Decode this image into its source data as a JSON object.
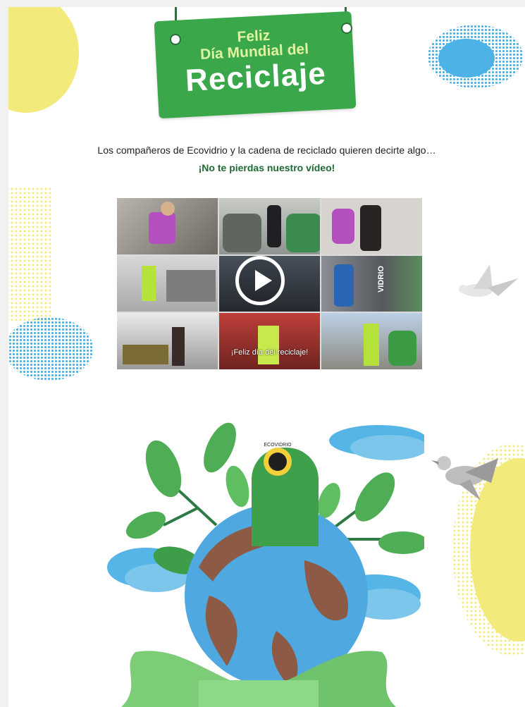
{
  "header": {
    "sign_line1": "Feliz",
    "sign_line2": "Día Mundial del",
    "sign_line3": "Reciclaje"
  },
  "intro": {
    "text": "Los compañeros de Ecovidrio y la cadena de reciclado quieren decirte algo…",
    "cta": "¡No te pierdas nuestro vídeo!"
  },
  "video": {
    "caption": "¡Feliz día del reciclaje!",
    "container_label": "VIDRIO",
    "icon": "play-icon"
  },
  "illustration": {
    "badge": "ECOVIDRIO"
  },
  "colors": {
    "green": "#3aa84a",
    "dark_green": "#1e6a34",
    "blue": "#4db3e6",
    "yellow": "#f3ea7c"
  }
}
